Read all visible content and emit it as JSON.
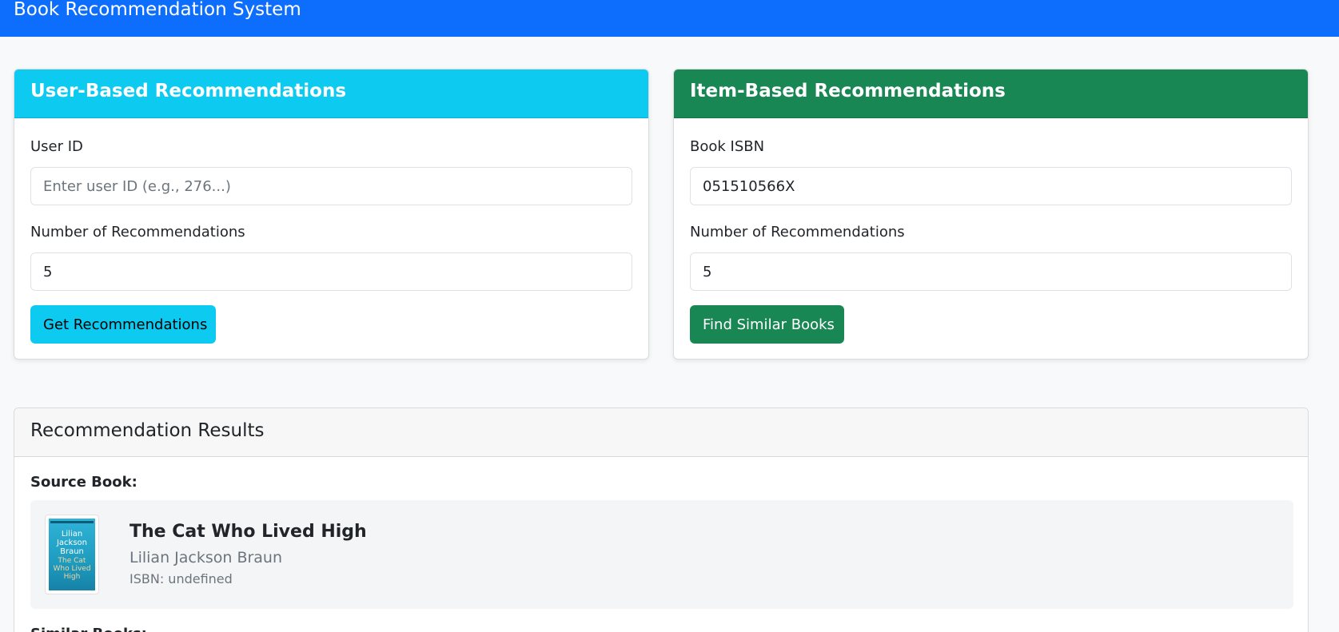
{
  "navbar": {
    "brand": "Book Recommendation System"
  },
  "user_card": {
    "header": "User-Based Recommendations",
    "user_id_label": "User ID",
    "user_id_placeholder": "Enter user ID (e.g., 276...)",
    "user_id_value": "",
    "num_label": "Number of Recommendations",
    "num_value": "5",
    "button": "Get Recommendations"
  },
  "item_card": {
    "header": "Item-Based Recommendations",
    "isbn_label": "Book ISBN",
    "isbn_value": "051510566X",
    "num_label": "Number of Recommendations",
    "num_value": "5",
    "button": "Find Similar Books"
  },
  "results": {
    "header": "Recommendation Results",
    "source_label": "Source Book:",
    "source_book": {
      "title": "The Cat Who Lived High",
      "author": "Lilian Jackson Braun",
      "isbn": "ISBN: undefined",
      "cover_author": "Lilian Jackson Braun",
      "cover_title": "The Cat Who Lived High"
    },
    "similar_label": "Similar Books:"
  },
  "colors": {
    "primary": "#0d6efd",
    "info": "#0dcaf0",
    "success": "#198754"
  }
}
